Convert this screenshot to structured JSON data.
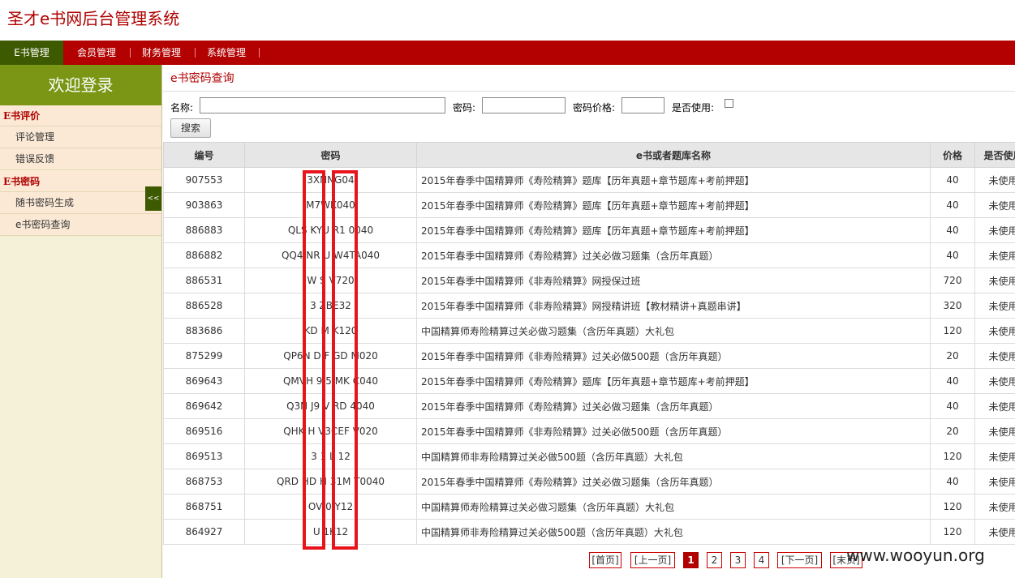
{
  "site_title": "圣才e书网后台管理系统",
  "topnav": [
    "E书管理",
    "会员管理",
    "财务管理",
    "系统管理"
  ],
  "sidebar": {
    "welcome": "欢迎登录",
    "groups": [
      {
        "heading": "E书评价",
        "items": [
          "评论管理",
          "错误反馈"
        ]
      },
      {
        "heading": "E书密码",
        "items": [
          "随书密码生成",
          "e书密码查询"
        ]
      }
    ],
    "collapse_label": "<<"
  },
  "page": {
    "title": "e书密码查询",
    "search": {
      "name_label": "名称:",
      "password_label": "密码:",
      "price_label": "密码价格:",
      "used_label": "是否使用:",
      "button": "搜索"
    }
  },
  "table": {
    "headers": [
      "编号",
      "密码",
      "e书或者题库名称",
      "价格",
      "是否使用"
    ],
    "rows": [
      [
        "907553",
        "3XNNG04",
        "2015年春季中国精算师《寿险精算》题库【历年真题+章节题库+考前押题】",
        "40",
        "未使用"
      ],
      [
        "903863",
        "M7WK040",
        "2015年春季中国精算师《寿险精算》题库【历年真题+章节题库+考前押题】",
        "40",
        "未使用"
      ],
      [
        "886883",
        "QLS KYU R1 0040",
        "2015年春季中国精算师《寿险精算》题库【历年真题+章节题库+考前押题】",
        "40",
        "未使用"
      ],
      [
        "886882",
        "QQ4 NR U W4TA040",
        "2015年春季中国精算师《寿险精算》过关必做习题集（含历年真题）",
        "40",
        "未使用"
      ],
      [
        "886531",
        "W S V720",
        "2015年春季中国精算师《非寿险精算》网授保过班",
        "720",
        "未使用"
      ],
      [
        "886528",
        "3 ZBE32",
        "2015年春季中国精算师《非寿险精算》网授精讲班【教材精讲+真题串讲】",
        "320",
        "未使用"
      ],
      [
        "883686",
        "KD M K120",
        "中国精算师寿险精算过关必做习题集（含历年真题）大礼包",
        "120",
        "未使用"
      ],
      [
        "875299",
        "QP6N D F GD M020",
        "2015年春季中国精算师《非寿险精算》过关必做500题（含历年真题）",
        "20",
        "未使用"
      ],
      [
        "869643",
        "QMVH 9 5 MK C040",
        "2015年春季中国精算师《寿险精算》题库【历年真题+章节题库+考前押题】",
        "40",
        "未使用"
      ],
      [
        "869642",
        "Q3N J9 V RD 4040",
        "2015年春季中国精算师《寿险精算》过关必做习题集（含历年真题）",
        "40",
        "未使用"
      ],
      [
        "869516",
        "QHK H V3CEF V020",
        "2015年春季中国精算师《非寿险精算》过关必做500题（含历年真题）",
        "20",
        "未使用"
      ],
      [
        "869513",
        "3 1 L 12",
        "中国精算师非寿险精算过关必做500题（含历年真题）大礼包",
        "120",
        "未使用"
      ],
      [
        "868753",
        "QRD HD H 31M T0040",
        "2015年春季中国精算师《寿险精算》过关必做习题集（含历年真题）",
        "40",
        "未使用"
      ],
      [
        "868751",
        "OV 0 Y12",
        "中国精算师寿险精算过关必做习题集（含历年真题）大礼包",
        "120",
        "未使用"
      ],
      [
        "864927",
        "U 1K12",
        "中国精算师非寿险精算过关必做500题（含历年真题）大礼包",
        "120",
        "未使用"
      ]
    ]
  },
  "pager": [
    "[首页]",
    "[上一页]",
    "1",
    "2",
    "3",
    "4",
    "[下一页]",
    "[末页]"
  ],
  "watermark": "www.wooyun.org",
  "colors": {
    "brand_red": "#b30000",
    "nav_active": "#3d5a00",
    "welcome_green": "#7a9614",
    "highlight_box": "#e8141c"
  }
}
